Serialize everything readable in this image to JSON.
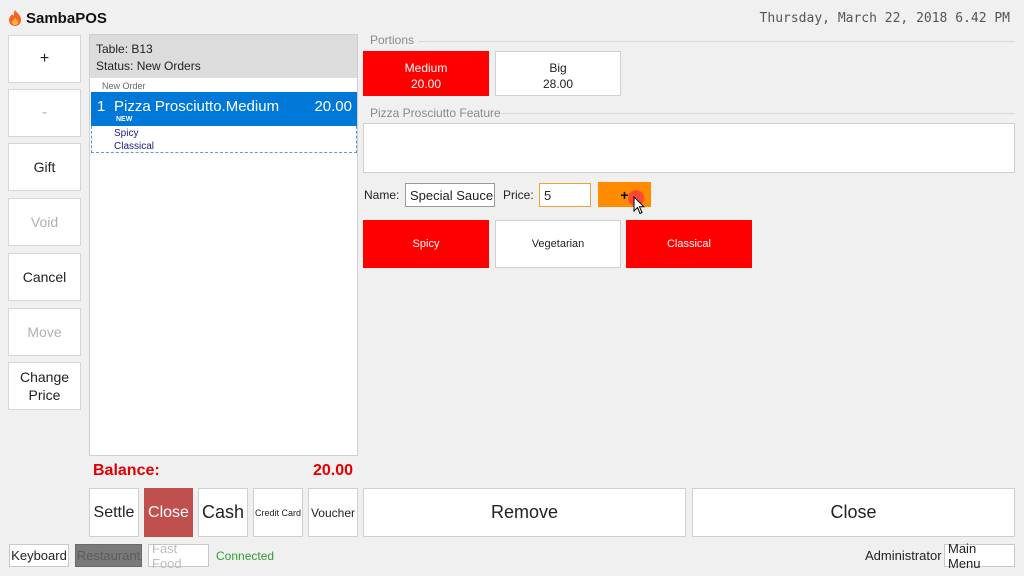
{
  "app": {
    "title": "SambaPOS",
    "datetime": "Thursday, March 22, 2018 6.42 PM"
  },
  "side_buttons": {
    "plus": "+",
    "minus": "-",
    "gift": "Gift",
    "void": "Void",
    "cancel": "Cancel",
    "move": "Move",
    "change_price_1": "Change",
    "change_price_2": "Price"
  },
  "ticket": {
    "table": "Table: B13",
    "status": "Status: New Orders",
    "new_order_label": "New Order",
    "order": {
      "qty": "1",
      "name": "Pizza Prosciutto.Medium",
      "price": "20.00",
      "badge": "NEW",
      "tags": [
        "Spicy",
        "Classical"
      ]
    }
  },
  "balance": {
    "label": "Balance:",
    "value": "20.00"
  },
  "payment_buttons": {
    "settle": "Settle",
    "close": "Close",
    "cash": "Cash",
    "credit_card": "Credit Card",
    "voucher": "Voucher"
  },
  "actions": {
    "remove": "Remove",
    "close": "Close"
  },
  "portions": {
    "section_label": "Portions",
    "items": [
      {
        "name": "Medium",
        "price": "20.00"
      },
      {
        "name": "Big",
        "price": "28.00"
      }
    ]
  },
  "feature": {
    "section_label": "Pizza Prosciutto Feature"
  },
  "custom_tag": {
    "name_label": "Name:",
    "name_value": "Special Sauce",
    "price_label": "Price:",
    "price_value": "5",
    "add_label": "+"
  },
  "tags": [
    "Spicy",
    "Vegetarian",
    "Classical"
  ],
  "status_bar": {
    "keyboard": "Keyboard",
    "restaurant": "Restaurant",
    "fast_food": "Fast Food",
    "connected": "Connected",
    "user": "Administrator",
    "main_menu": "Main Menu"
  },
  "colors": {
    "selected": "#ff0000",
    "accent_blue": "#0078d7",
    "add_button": "#ff8c00",
    "close_button": "#c0504d",
    "balance": "#e00000",
    "connected": "#2e9e2e"
  },
  "icons": {
    "logo": "sambapos-flame-icon",
    "cursor": "mouse-pointer-icon"
  }
}
